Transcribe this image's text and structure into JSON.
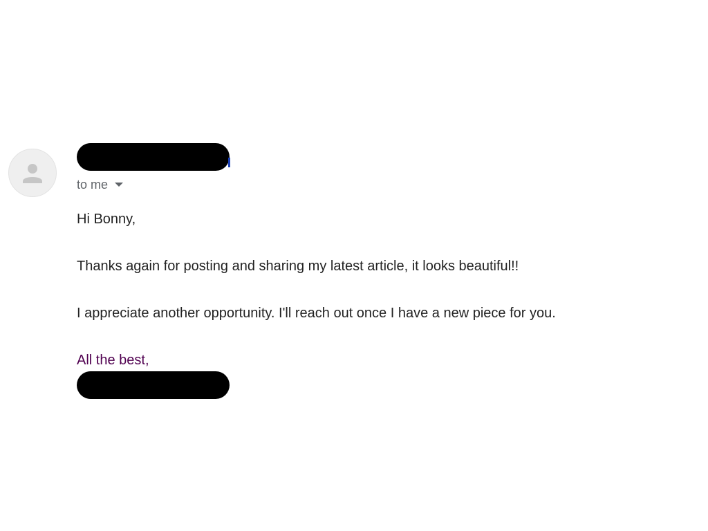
{
  "email": {
    "recipient": {
      "label": "to me",
      "dropdown_icon": "chevron-down-icon"
    },
    "body": {
      "greeting": "Hi Bonny,",
      "paragraph_1": "Thanks again for posting and sharing my latest article, it looks beautiful!!",
      "paragraph_2": "I appreciate another opportunity. I'll reach out once I have a new piece for you.",
      "sign_off": "All the best,"
    }
  },
  "colors": {
    "background": "#ffffff",
    "body_text": "#222222",
    "secondary_text": "#5f6368",
    "signature_text": "#500050",
    "redaction": "#000000",
    "avatar_background": "#efefef",
    "avatar_icon": "#c6c6c6"
  }
}
